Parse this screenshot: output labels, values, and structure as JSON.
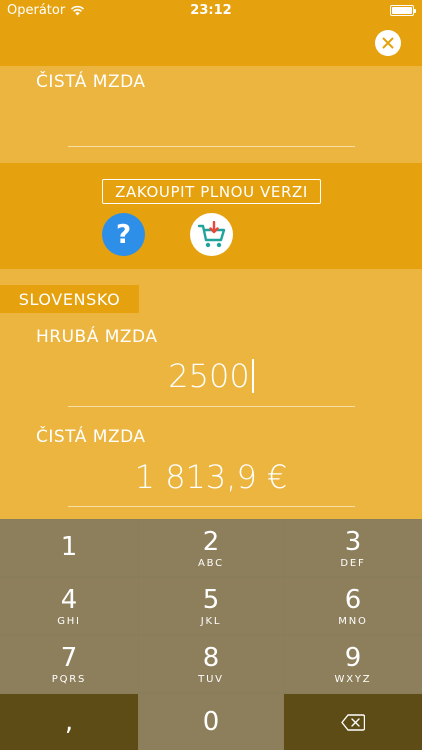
{
  "status_bar": {
    "carrier": "Operátor",
    "time": "23:12"
  },
  "top_result": {
    "label": "ČISTÁ MZDA",
    "value": ""
  },
  "promo": {
    "buy_label": "ZAKOUPIT PLNOU VERZI",
    "help_label": "?"
  },
  "calculator": {
    "country": "SLOVENSKO",
    "gross_label": "HRUBÁ MZDA",
    "gross_value": "2500",
    "net_label": "ČISTÁ MZDA",
    "net_value": "1 813,9 €"
  },
  "keyboard": {
    "keys": [
      {
        "num": "1",
        "letters": ""
      },
      {
        "num": "2",
        "letters": "ABC"
      },
      {
        "num": "3",
        "letters": "DEF"
      },
      {
        "num": "4",
        "letters": "GHI"
      },
      {
        "num": "5",
        "letters": "JKL"
      },
      {
        "num": "6",
        "letters": "MNO"
      },
      {
        "num": "7",
        "letters": "PQRS"
      },
      {
        "num": "8",
        "letters": "TUV"
      },
      {
        "num": "9",
        "letters": "WXYZ"
      },
      {
        "num": ",",
        "letters": ""
      },
      {
        "num": "0",
        "letters": ""
      }
    ]
  },
  "colors": {
    "accent": "#E5A20E",
    "panel": "#EBB53F",
    "help": "#2E8FE8",
    "cart": "#1FA39A",
    "cart_arrow": "#E8473A",
    "keyboard": "#8D7F5B",
    "keyboard_dark": "#5E4C16"
  },
  "icons": {
    "wifi": "wifi-icon",
    "battery": "battery-icon",
    "close": "close-icon",
    "help": "question-icon",
    "cart": "cart-download-icon",
    "backspace": "backspace-icon"
  }
}
